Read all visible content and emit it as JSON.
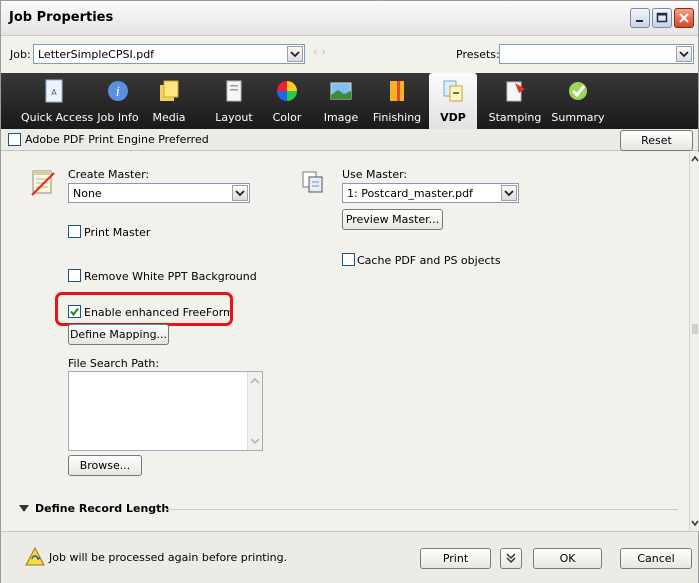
{
  "window": {
    "title": "Job Properties"
  },
  "job": {
    "label": "Job:",
    "value": "LetterSimpleCPSI.pdf",
    "nav_prev": "‹",
    "nav_next": "›"
  },
  "presets": {
    "label": "Presets:",
    "value": ""
  },
  "toolbar": {
    "tabs": [
      {
        "label": "Quick Access",
        "icon": "quick-access-icon"
      },
      {
        "label": "Job Info",
        "icon": "info-icon"
      },
      {
        "label": "Media",
        "icon": "media-icon"
      },
      {
        "label": "Layout",
        "icon": "layout-icon"
      },
      {
        "label": "Color",
        "icon": "color-wheel-icon"
      },
      {
        "label": "Image",
        "icon": "image-icon"
      },
      {
        "label": "Finishing",
        "icon": "finishing-icon"
      },
      {
        "label": "VDP",
        "icon": "vdp-icon",
        "active": true
      },
      {
        "label": "Stamping",
        "icon": "stamping-icon"
      },
      {
        "label": "Summary",
        "icon": "summary-check-icon"
      }
    ]
  },
  "prefrow": {
    "pdf_engine_label": "Adobe PDF Print Engine Preferred",
    "pdf_engine_checked": false,
    "reset_label": "Reset"
  },
  "vdp": {
    "create_master_label": "Create Master:",
    "create_master_value": "None",
    "print_master_label": "Print Master",
    "print_master_checked": false,
    "remove_white_label": "Remove White PPT Background",
    "remove_white_checked": false,
    "enhanced_freeform_label": "Enable enhanced FreeForm",
    "enhanced_freeform_checked": true,
    "define_mapping_label": "Define Mapping...",
    "file_search_path_label": "File Search Path:",
    "file_search_path_value": "",
    "browse_label": "Browse...",
    "use_master_label": "Use Master:",
    "use_master_value": "1: Postcard_master.pdf",
    "preview_master_label": "Preview Master...",
    "cache_pdf_label": "Cache PDF and PS objects",
    "cache_pdf_checked": false,
    "define_record_length_label": "Define Record Length"
  },
  "footer": {
    "status": "Job will be processed again before printing.",
    "print_label": "Print",
    "ok_label": "OK",
    "cancel_label": "Cancel"
  },
  "colors": {
    "highlight": "#e8141a",
    "toolbar_bg": "#1a1a1a"
  }
}
